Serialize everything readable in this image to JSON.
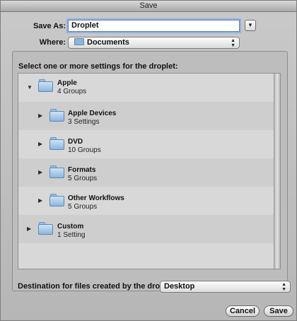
{
  "window": {
    "title": "Save"
  },
  "save_as": {
    "label": "Save As:",
    "value": "Droplet"
  },
  "where": {
    "label": "Where:",
    "value": "Documents"
  },
  "settings": {
    "heading": "Select one or more settings for the droplet:",
    "items": [
      {
        "name": "Apple",
        "sub": "4 Groups",
        "expanded": true,
        "level": 0
      },
      {
        "name": "Apple Devices",
        "sub": "3 Settings",
        "expanded": false,
        "level": 1
      },
      {
        "name": "DVD",
        "sub": "10 Groups",
        "expanded": false,
        "level": 1
      },
      {
        "name": "Formats",
        "sub": "5 Groups",
        "expanded": false,
        "level": 1
      },
      {
        "name": "Other Workflows",
        "sub": "5 Groups",
        "expanded": false,
        "level": 1
      },
      {
        "name": "Custom",
        "sub": "1 Setting",
        "expanded": false,
        "level": 0
      }
    ]
  },
  "destination": {
    "label": "Destination for files created by the droplet:",
    "value": "Desktop"
  },
  "buttons": {
    "cancel": "Cancel",
    "save": "Save"
  },
  "glyphs": {
    "expanded": "▼",
    "collapsed": "▶",
    "popup_arrows_up": "▲",
    "popup_arrows_down": "▼",
    "expand_toggle": "▼"
  }
}
